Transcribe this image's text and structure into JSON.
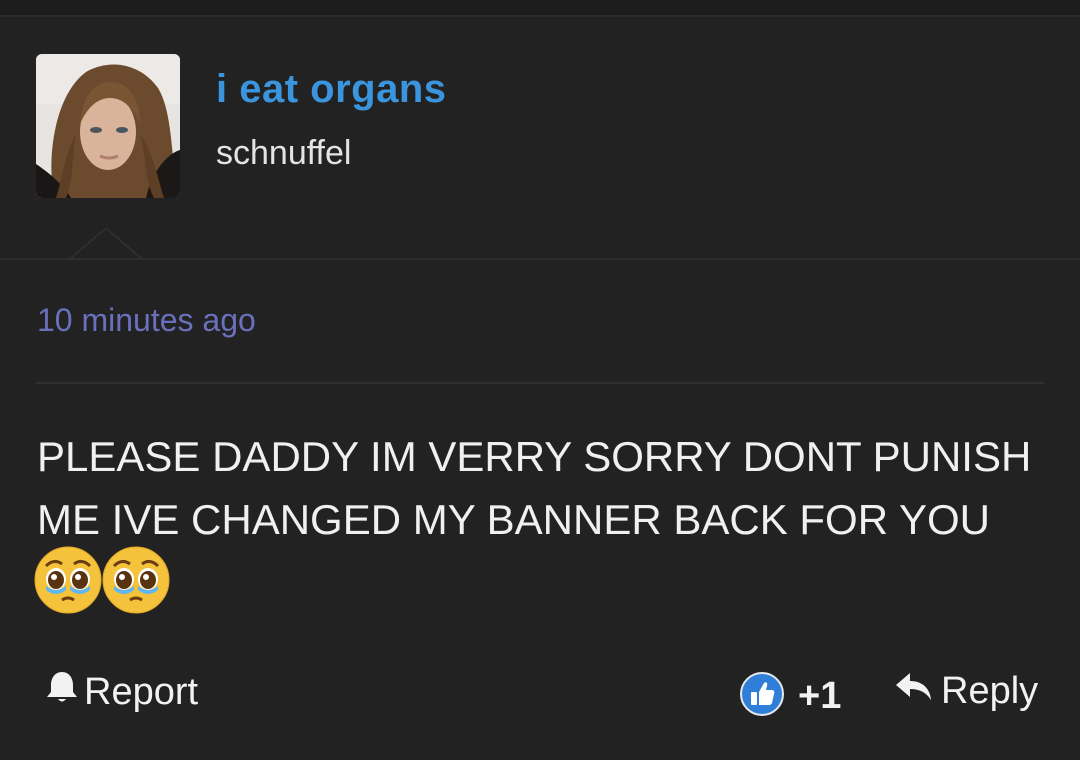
{
  "author": {
    "display_name": "i eat organs",
    "username": "schnuffel",
    "avatar_icon": "profile-photo"
  },
  "comment": {
    "timestamp": "10 minutes ago",
    "text": "PLEASE DADDY IM VERRY SORRY DONT PUNISH ME IVE CHANGED MY BANNER BACK FOR YOU",
    "emojis": [
      "pleading-face-emoji",
      "pleading-face-emoji"
    ]
  },
  "actions": {
    "report_label": "Report",
    "report_icon": "bell-icon",
    "like_icon": "thumbs-up-icon",
    "like_count": "+1",
    "reply_label": "Reply",
    "reply_icon": "reply-arrow-icon"
  },
  "colors": {
    "background": "#222222",
    "display_name": "#3a95de",
    "timestamp": "#6a70bd",
    "text": "#f0f0f0",
    "like_badge": "#2f7fd8"
  }
}
